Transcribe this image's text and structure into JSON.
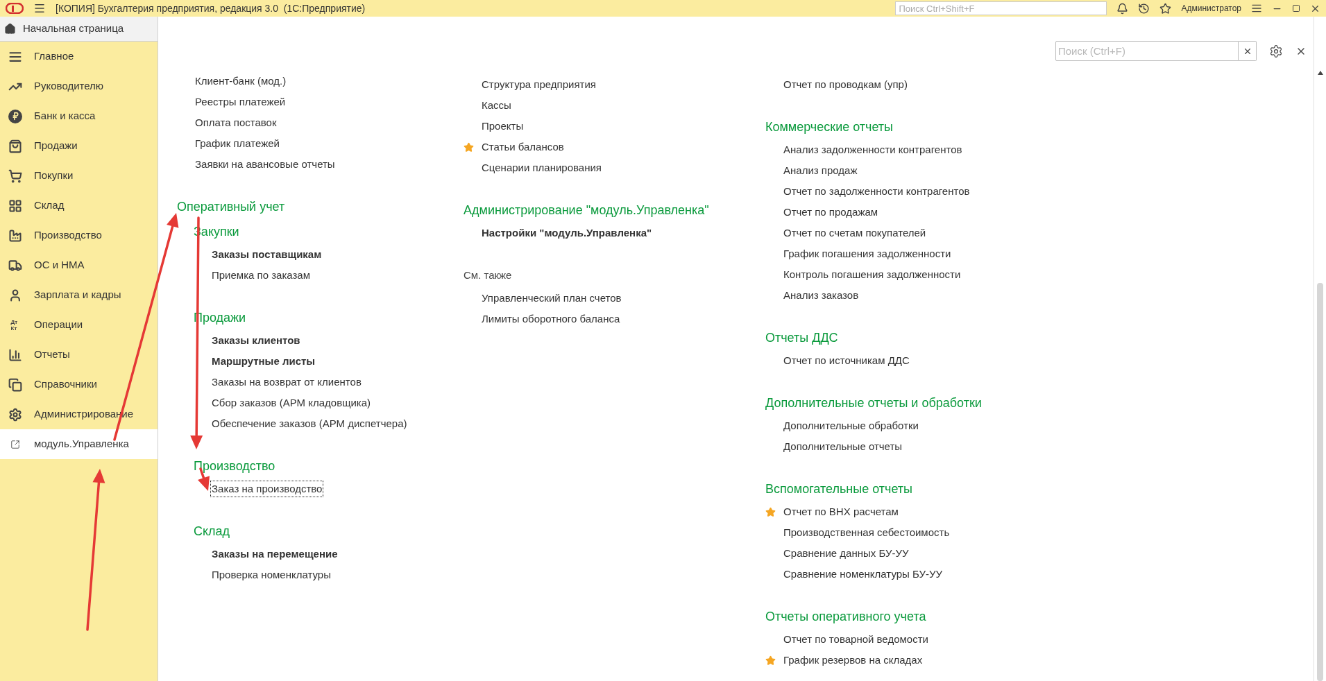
{
  "title_bar": {
    "title": "[КОПИЯ] Бухгалтерия предприятия, редакция 3.0  (1С:Предприятие)",
    "search_placeholder": "Поиск Ctrl+Shift+F",
    "user": "Администратор"
  },
  "tabs": [
    {
      "label": "Начальная страница",
      "selected": true
    }
  ],
  "sidebar": {
    "items": [
      {
        "label": "Главное",
        "selected": false
      },
      {
        "label": "Руководителю",
        "selected": false
      },
      {
        "label": "Банк и касса",
        "selected": false
      },
      {
        "label": "Продажи",
        "selected": false
      },
      {
        "label": "Покупки",
        "selected": false
      },
      {
        "label": "Склад",
        "selected": false
      },
      {
        "label": "Производство",
        "selected": false
      },
      {
        "label": "ОС и НМА",
        "selected": false
      },
      {
        "label": "Зарплата и кадры",
        "selected": false
      },
      {
        "label": "Операции",
        "selected": false,
        "icon_text": "Дт Кт"
      },
      {
        "label": "Отчеты",
        "selected": false
      },
      {
        "label": "Справочники",
        "selected": false
      },
      {
        "label": "Администрирование",
        "selected": false
      },
      {
        "label": "модуль.Управленка",
        "selected": true
      }
    ]
  },
  "panel": {
    "search": {
      "placeholder": "Поиск (Ctrl+F)"
    },
    "columns": [
      [
        {
          "kind": "group",
          "items": [
            {
              "label": "Клиент-банк (мод.)",
              "bold": false,
              "favorite": false,
              "focused": false
            },
            {
              "label": "Реестры платежей",
              "bold": false,
              "favorite": false,
              "focused": false
            },
            {
              "label": "Оплата поставок",
              "bold": false,
              "favorite": false,
              "focused": false
            },
            {
              "label": "График платежей",
              "bold": false,
              "favorite": false,
              "focused": false
            },
            {
              "label": "Заявки на авансовые отчеты",
              "bold": false,
              "favorite": false,
              "focused": false
            }
          ]
        },
        {
          "kind": "area",
          "title": "Оперативный учет",
          "groups": [
            {
              "kind": "group",
              "title": "Закупки",
              "items": [
                {
                  "label": "Заказы поставщикам",
                  "bold": true,
                  "favorite": false,
                  "focused": false
                },
                {
                  "label": "Приемка по заказам",
                  "bold": false,
                  "favorite": false,
                  "focused": false
                }
              ]
            },
            {
              "kind": "group",
              "title": "Продажи",
              "items": [
                {
                  "label": "Заказы клиентов",
                  "bold": true,
                  "favorite": false,
                  "focused": false
                },
                {
                  "label": "Маршрутные листы",
                  "bold": true,
                  "favorite": false,
                  "focused": false
                },
                {
                  "label": "Заказы на возврат от клиентов",
                  "bold": false,
                  "favorite": false,
                  "focused": false
                },
                {
                  "label": "Сбор заказов (АРМ кладовщика)",
                  "bold": false,
                  "favorite": false,
                  "focused": false
                },
                {
                  "label": "Обеспечение заказов (АРМ диспетчера)",
                  "bold": false,
                  "favorite": false,
                  "focused": false
                }
              ]
            },
            {
              "kind": "group",
              "title": "Производство",
              "items": [
                {
                  "label": "Заказ на производство",
                  "bold": false,
                  "favorite": false,
                  "focused": true
                }
              ]
            },
            {
              "kind": "group",
              "title": "Склад",
              "items": [
                {
                  "label": "Заказы на перемещение",
                  "bold": true,
                  "favorite": false,
                  "focused": false
                },
                {
                  "label": "Проверка номенклатуры",
                  "bold": false,
                  "favorite": false,
                  "focused": false
                }
              ]
            }
          ]
        }
      ],
      [
        {
          "kind": "group",
          "items": [
            {
              "label": "Структура предприятия",
              "bold": false,
              "favorite": false,
              "focused": false
            },
            {
              "label": "Кассы",
              "bold": false,
              "favorite": false,
              "focused": false
            },
            {
              "label": "Проекты",
              "bold": false,
              "favorite": false,
              "focused": false
            },
            {
              "label": "Статьи балансов",
              "bold": false,
              "favorite": true,
              "focused": false
            },
            {
              "label": "Сценарии планирования",
              "bold": false,
              "favorite": false,
              "focused": false
            }
          ]
        },
        {
          "kind": "group",
          "title": "Администрирование \"модуль.Управленка\"",
          "items": [
            {
              "label": "Настройки \"модуль.Управленка\"",
              "bold": true,
              "favorite": false,
              "focused": false
            }
          ]
        },
        {
          "kind": "see_also",
          "title": "См. также",
          "items": [
            {
              "label": "Управленческий план счетов",
              "bold": false,
              "favorite": false,
              "focused": false
            },
            {
              "label": "Лимиты оборотного баланса",
              "bold": false,
              "favorite": false,
              "focused": false
            }
          ]
        }
      ],
      [
        {
          "kind": "group",
          "items": [
            {
              "label": "Отчет по проводкам (упр)",
              "bold": false,
              "favorite": false,
              "focused": false
            }
          ]
        },
        {
          "kind": "group",
          "title": "Коммерческие отчеты",
          "items": [
            {
              "label": "Анализ задолженности контрагентов",
              "bold": false,
              "favorite": false,
              "focused": false
            },
            {
              "label": "Анализ продаж",
              "bold": false,
              "favorite": false,
              "focused": false
            },
            {
              "label": "Отчет по задолженности контрагентов",
              "bold": false,
              "favorite": false,
              "focused": false
            },
            {
              "label": "Отчет по продажам",
              "bold": false,
              "favorite": false,
              "focused": false
            },
            {
              "label": "Отчет по счетам покупателей",
              "bold": false,
              "favorite": false,
              "focused": false
            },
            {
              "label": "График погашения задолженности",
              "bold": false,
              "favorite": false,
              "focused": false
            },
            {
              "label": "Контроль погашения задолженности",
              "bold": false,
              "favorite": false,
              "focused": false
            },
            {
              "label": "Анализ заказов",
              "bold": false,
              "favorite": false,
              "focused": false
            }
          ]
        },
        {
          "kind": "group",
          "title": "Отчеты ДДС",
          "items": [
            {
              "label": "Отчет по источникам ДДС",
              "bold": false,
              "favorite": false,
              "focused": false
            }
          ]
        },
        {
          "kind": "group",
          "title": "Дополнительные отчеты и обработки",
          "items": [
            {
              "label": "Дополнительные обработки",
              "bold": false,
              "favorite": false,
              "focused": false
            },
            {
              "label": "Дополнительные отчеты",
              "bold": false,
              "favorite": false,
              "focused": false
            }
          ]
        },
        {
          "kind": "group",
          "title": "Вспомогательные отчеты",
          "items": [
            {
              "label": "Отчет по ВНХ расчетам",
              "bold": false,
              "favorite": true,
              "focused": false
            },
            {
              "label": "Производственная себестоимость",
              "bold": false,
              "favorite": false,
              "focused": false
            },
            {
              "label": "Сравнение данных БУ-УУ",
              "bold": false,
              "favorite": false,
              "focused": false
            },
            {
              "label": "Сравнение номенклатуры БУ-УУ",
              "bold": false,
              "favorite": false,
              "focused": false
            }
          ]
        },
        {
          "kind": "group",
          "title": "Отчеты оперативного учета",
          "items": [
            {
              "label": "Отчет по товарной ведомости",
              "bold": false,
              "favorite": false,
              "focused": false
            },
            {
              "label": "График резервов на складах",
              "bold": false,
              "favorite": true,
              "focused": false
            }
          ]
        }
      ]
    ]
  }
}
